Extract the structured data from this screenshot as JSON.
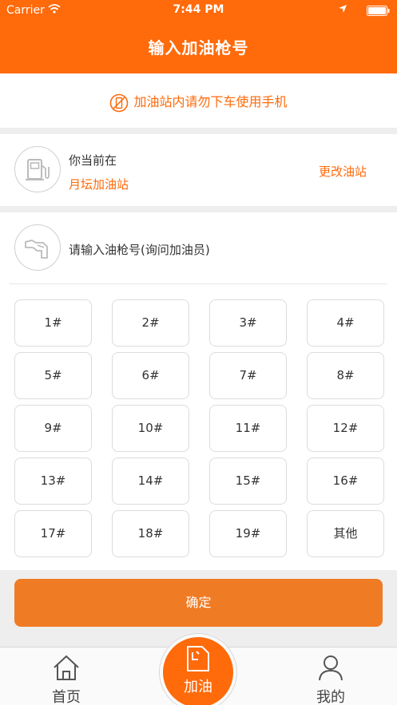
{
  "status_bar": {
    "carrier": "Carrier",
    "time": "7:44 PM"
  },
  "header": {
    "title": "输入加油枪号"
  },
  "notice": {
    "text": "加油站内请勿下车使用手机"
  },
  "station": {
    "label": "你当前在",
    "name": "月坛加油站",
    "change_label": "更改油站"
  },
  "pump": {
    "prompt": "请输入油枪号(询问加油员)",
    "buttons": [
      "1#",
      "2#",
      "3#",
      "4#",
      "5#",
      "6#",
      "7#",
      "8#",
      "9#",
      "10#",
      "11#",
      "12#",
      "13#",
      "14#",
      "15#",
      "16#",
      "17#",
      "18#",
      "19#",
      "其他"
    ]
  },
  "confirm": {
    "label": "确定"
  },
  "tabbar": {
    "home": "首页",
    "fuel": "加油",
    "mine": "我的"
  },
  "colors": {
    "accent": "#ff6a0a",
    "confirm": "#f07b25"
  }
}
